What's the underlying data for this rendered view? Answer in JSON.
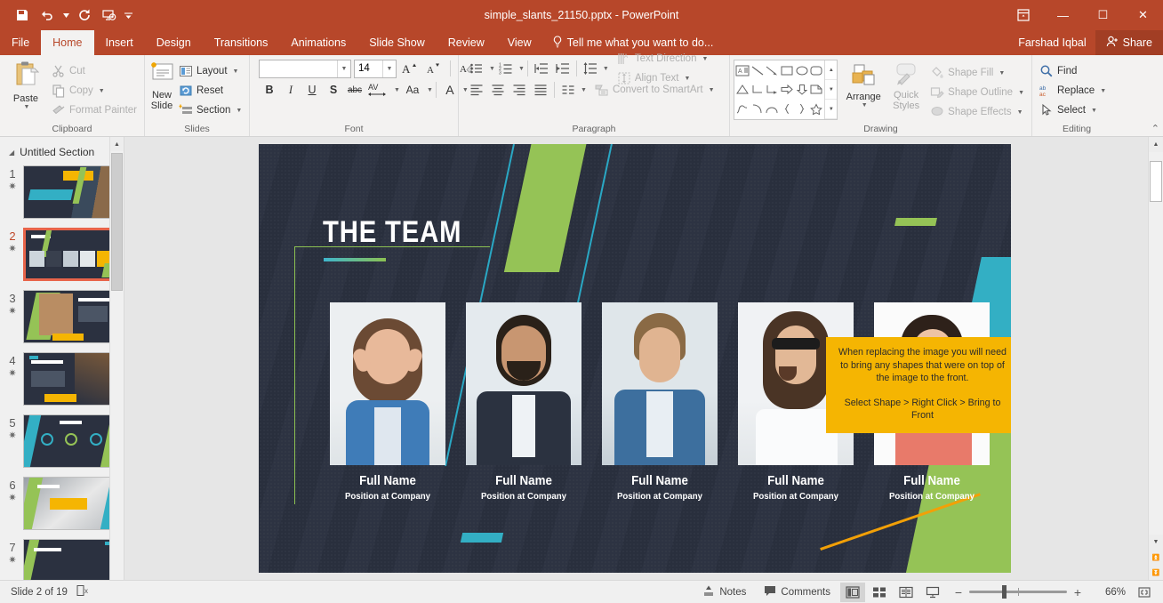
{
  "window": {
    "title": "simple_slants_21150.pptx - PowerPoint",
    "quick_access": [
      {
        "name": "save-icon",
        "label": "Save"
      },
      {
        "name": "undo-icon",
        "label": "Undo"
      },
      {
        "name": "redo-icon",
        "label": "Redo"
      },
      {
        "name": "start-presentation-icon",
        "label": "Start From Beginning"
      },
      {
        "name": "customize-qat-icon",
        "label": "Customize Quick Access Toolbar"
      }
    ],
    "controls": {
      "ribbon_options": "ribbon-display-options-icon",
      "minimize": "—",
      "restore": "☐",
      "close": "✕"
    }
  },
  "tabs": [
    {
      "label": "File",
      "active": false
    },
    {
      "label": "Home",
      "active": true
    },
    {
      "label": "Insert",
      "active": false
    },
    {
      "label": "Design",
      "active": false
    },
    {
      "label": "Transitions",
      "active": false
    },
    {
      "label": "Animations",
      "active": false
    },
    {
      "label": "Slide Show",
      "active": false
    },
    {
      "label": "Review",
      "active": false
    },
    {
      "label": "View",
      "active": false
    }
  ],
  "tellme": {
    "placeholder": "Tell me what you want to do...",
    "icon": "lightbulb-icon"
  },
  "account": {
    "user": "Farshad Iqbal",
    "share_label": "Share",
    "share_icon": "share-person-icon"
  },
  "ribbon": {
    "clipboard": {
      "label": "Clipboard",
      "paste": "Paste",
      "cut": "Cut",
      "copy": "Copy",
      "format_painter": "Format Painter"
    },
    "slides": {
      "label": "Slides",
      "new_slide": "New\nSlide",
      "new_slide_line1": "New",
      "new_slide_line2": "Slide",
      "layout": "Layout",
      "reset": "Reset",
      "section": "Section"
    },
    "font": {
      "label": "Font",
      "font_name": "",
      "font_name_placeholder": "",
      "font_size": "14",
      "grow": "A",
      "shrink": "A",
      "clear_formatting": "Clear All Formatting",
      "bold": "B",
      "italic": "I",
      "underline": "U",
      "shadow": "S",
      "strikethrough": "abc",
      "character_spacing": "AV",
      "change_case": "Aa",
      "font_color": "A"
    },
    "paragraph": {
      "label": "Paragraph",
      "text_direction": "Text Direction",
      "align_text": "Align Text",
      "convert_smartart": "Convert to SmartArt"
    },
    "drawing": {
      "label": "Drawing",
      "arrange": "Arrange",
      "quick_styles_line1": "Quick",
      "quick_styles_line2": "Styles",
      "shape_fill": "Shape Fill",
      "shape_outline": "Shape Outline",
      "shape_effects": "Shape Effects",
      "shapes": [
        "text-box",
        "line",
        "line-arrow",
        "rectangle",
        "oval",
        "rounded-rectangle",
        "triangle",
        "elbow-connector",
        "elbow-arrow-connector",
        "right-arrow",
        "down-arrow",
        "folded-corner",
        "freeform",
        "arc",
        "curve",
        "left-brace",
        "right-brace",
        "star"
      ]
    },
    "editing": {
      "label": "Editing",
      "find": "Find",
      "replace": "Replace",
      "select": "Select"
    },
    "collapse": "collapse-ribbon-icon"
  },
  "thumbnails": {
    "section": "Untitled Section",
    "slides": [
      {
        "number": "1",
        "selected": false
      },
      {
        "number": "2",
        "selected": true
      },
      {
        "number": "3",
        "selected": false
      },
      {
        "number": "4",
        "selected": false
      },
      {
        "number": "5",
        "selected": false
      },
      {
        "number": "6",
        "selected": false
      },
      {
        "number": "7",
        "selected": false
      }
    ]
  },
  "slide": {
    "title": "THE TEAM",
    "members": [
      {
        "name": "Full Name",
        "position": "Position at Company"
      },
      {
        "name": "Full Name",
        "position": "Position at Company"
      },
      {
        "name": "Full Name",
        "position": "Position at Company"
      },
      {
        "name": "Full Name",
        "position": "Position at Company"
      },
      {
        "name": "Full Name",
        "position": "Position at Company"
      }
    ],
    "note": {
      "paragraph1": "When replacing the image you will need to bring any shapes that were on top of the image to the front.",
      "paragraph2": "Select Shape > Right Click > Bring to Front"
    },
    "colors": {
      "background": "#2b3140",
      "green": "#95c356",
      "teal": "#33afc4",
      "note_yellow": "#f5b502",
      "orange_line": "#f2a007"
    }
  },
  "status": {
    "slide_counter": "Slide 2 of 19",
    "accessibility_icon": "accessibility-check-icon",
    "notes": "Notes",
    "comments": "Comments",
    "views": [
      {
        "name": "normal-view",
        "active": true
      },
      {
        "name": "slide-sorter-view",
        "active": false
      },
      {
        "name": "reading-view",
        "active": false
      },
      {
        "name": "slide-show-view",
        "active": false
      }
    ],
    "zoom_out": "−",
    "zoom_in": "+",
    "zoom_level": "66%",
    "fit_to_window": "fit-slide-to-window-icon"
  }
}
